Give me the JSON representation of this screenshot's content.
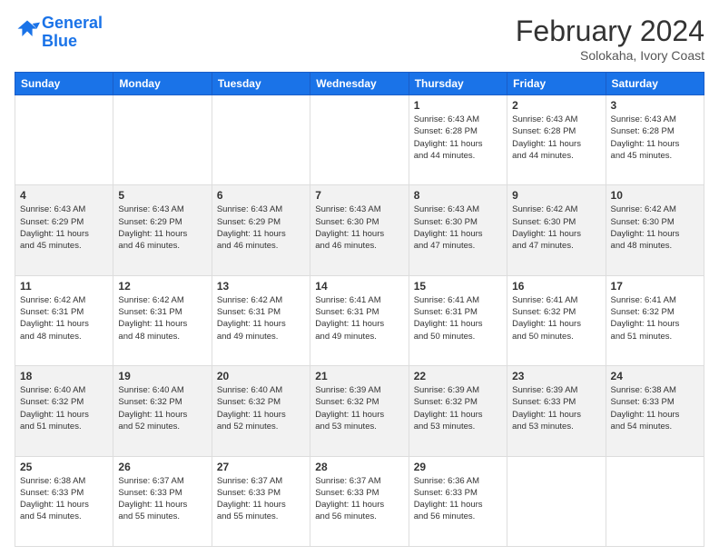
{
  "header": {
    "logo_line1": "General",
    "logo_line2": "Blue",
    "month_title": "February 2024",
    "subtitle": "Solokaha, Ivory Coast"
  },
  "weekdays": [
    "Sunday",
    "Monday",
    "Tuesday",
    "Wednesday",
    "Thursday",
    "Friday",
    "Saturday"
  ],
  "weeks": [
    [
      {
        "day": "",
        "info": ""
      },
      {
        "day": "",
        "info": ""
      },
      {
        "day": "",
        "info": ""
      },
      {
        "day": "",
        "info": ""
      },
      {
        "day": "1",
        "info": "Sunrise: 6:43 AM\nSunset: 6:28 PM\nDaylight: 11 hours\nand 44 minutes."
      },
      {
        "day": "2",
        "info": "Sunrise: 6:43 AM\nSunset: 6:28 PM\nDaylight: 11 hours\nand 44 minutes."
      },
      {
        "day": "3",
        "info": "Sunrise: 6:43 AM\nSunset: 6:28 PM\nDaylight: 11 hours\nand 45 minutes."
      }
    ],
    [
      {
        "day": "4",
        "info": "Sunrise: 6:43 AM\nSunset: 6:29 PM\nDaylight: 11 hours\nand 45 minutes."
      },
      {
        "day": "5",
        "info": "Sunrise: 6:43 AM\nSunset: 6:29 PM\nDaylight: 11 hours\nand 46 minutes."
      },
      {
        "day": "6",
        "info": "Sunrise: 6:43 AM\nSunset: 6:29 PM\nDaylight: 11 hours\nand 46 minutes."
      },
      {
        "day": "7",
        "info": "Sunrise: 6:43 AM\nSunset: 6:30 PM\nDaylight: 11 hours\nand 46 minutes."
      },
      {
        "day": "8",
        "info": "Sunrise: 6:43 AM\nSunset: 6:30 PM\nDaylight: 11 hours\nand 47 minutes."
      },
      {
        "day": "9",
        "info": "Sunrise: 6:42 AM\nSunset: 6:30 PM\nDaylight: 11 hours\nand 47 minutes."
      },
      {
        "day": "10",
        "info": "Sunrise: 6:42 AM\nSunset: 6:30 PM\nDaylight: 11 hours\nand 48 minutes."
      }
    ],
    [
      {
        "day": "11",
        "info": "Sunrise: 6:42 AM\nSunset: 6:31 PM\nDaylight: 11 hours\nand 48 minutes."
      },
      {
        "day": "12",
        "info": "Sunrise: 6:42 AM\nSunset: 6:31 PM\nDaylight: 11 hours\nand 48 minutes."
      },
      {
        "day": "13",
        "info": "Sunrise: 6:42 AM\nSunset: 6:31 PM\nDaylight: 11 hours\nand 49 minutes."
      },
      {
        "day": "14",
        "info": "Sunrise: 6:41 AM\nSunset: 6:31 PM\nDaylight: 11 hours\nand 49 minutes."
      },
      {
        "day": "15",
        "info": "Sunrise: 6:41 AM\nSunset: 6:31 PM\nDaylight: 11 hours\nand 50 minutes."
      },
      {
        "day": "16",
        "info": "Sunrise: 6:41 AM\nSunset: 6:32 PM\nDaylight: 11 hours\nand 50 minutes."
      },
      {
        "day": "17",
        "info": "Sunrise: 6:41 AM\nSunset: 6:32 PM\nDaylight: 11 hours\nand 51 minutes."
      }
    ],
    [
      {
        "day": "18",
        "info": "Sunrise: 6:40 AM\nSunset: 6:32 PM\nDaylight: 11 hours\nand 51 minutes."
      },
      {
        "day": "19",
        "info": "Sunrise: 6:40 AM\nSunset: 6:32 PM\nDaylight: 11 hours\nand 52 minutes."
      },
      {
        "day": "20",
        "info": "Sunrise: 6:40 AM\nSunset: 6:32 PM\nDaylight: 11 hours\nand 52 minutes."
      },
      {
        "day": "21",
        "info": "Sunrise: 6:39 AM\nSunset: 6:32 PM\nDaylight: 11 hours\nand 53 minutes."
      },
      {
        "day": "22",
        "info": "Sunrise: 6:39 AM\nSunset: 6:32 PM\nDaylight: 11 hours\nand 53 minutes."
      },
      {
        "day": "23",
        "info": "Sunrise: 6:39 AM\nSunset: 6:33 PM\nDaylight: 11 hours\nand 53 minutes."
      },
      {
        "day": "24",
        "info": "Sunrise: 6:38 AM\nSunset: 6:33 PM\nDaylight: 11 hours\nand 54 minutes."
      }
    ],
    [
      {
        "day": "25",
        "info": "Sunrise: 6:38 AM\nSunset: 6:33 PM\nDaylight: 11 hours\nand 54 minutes."
      },
      {
        "day": "26",
        "info": "Sunrise: 6:37 AM\nSunset: 6:33 PM\nDaylight: 11 hours\nand 55 minutes."
      },
      {
        "day": "27",
        "info": "Sunrise: 6:37 AM\nSunset: 6:33 PM\nDaylight: 11 hours\nand 55 minutes."
      },
      {
        "day": "28",
        "info": "Sunrise: 6:37 AM\nSunset: 6:33 PM\nDaylight: 11 hours\nand 56 minutes."
      },
      {
        "day": "29",
        "info": "Sunrise: 6:36 AM\nSunset: 6:33 PM\nDaylight: 11 hours\nand 56 minutes."
      },
      {
        "day": "",
        "info": ""
      },
      {
        "day": "",
        "info": ""
      }
    ]
  ]
}
